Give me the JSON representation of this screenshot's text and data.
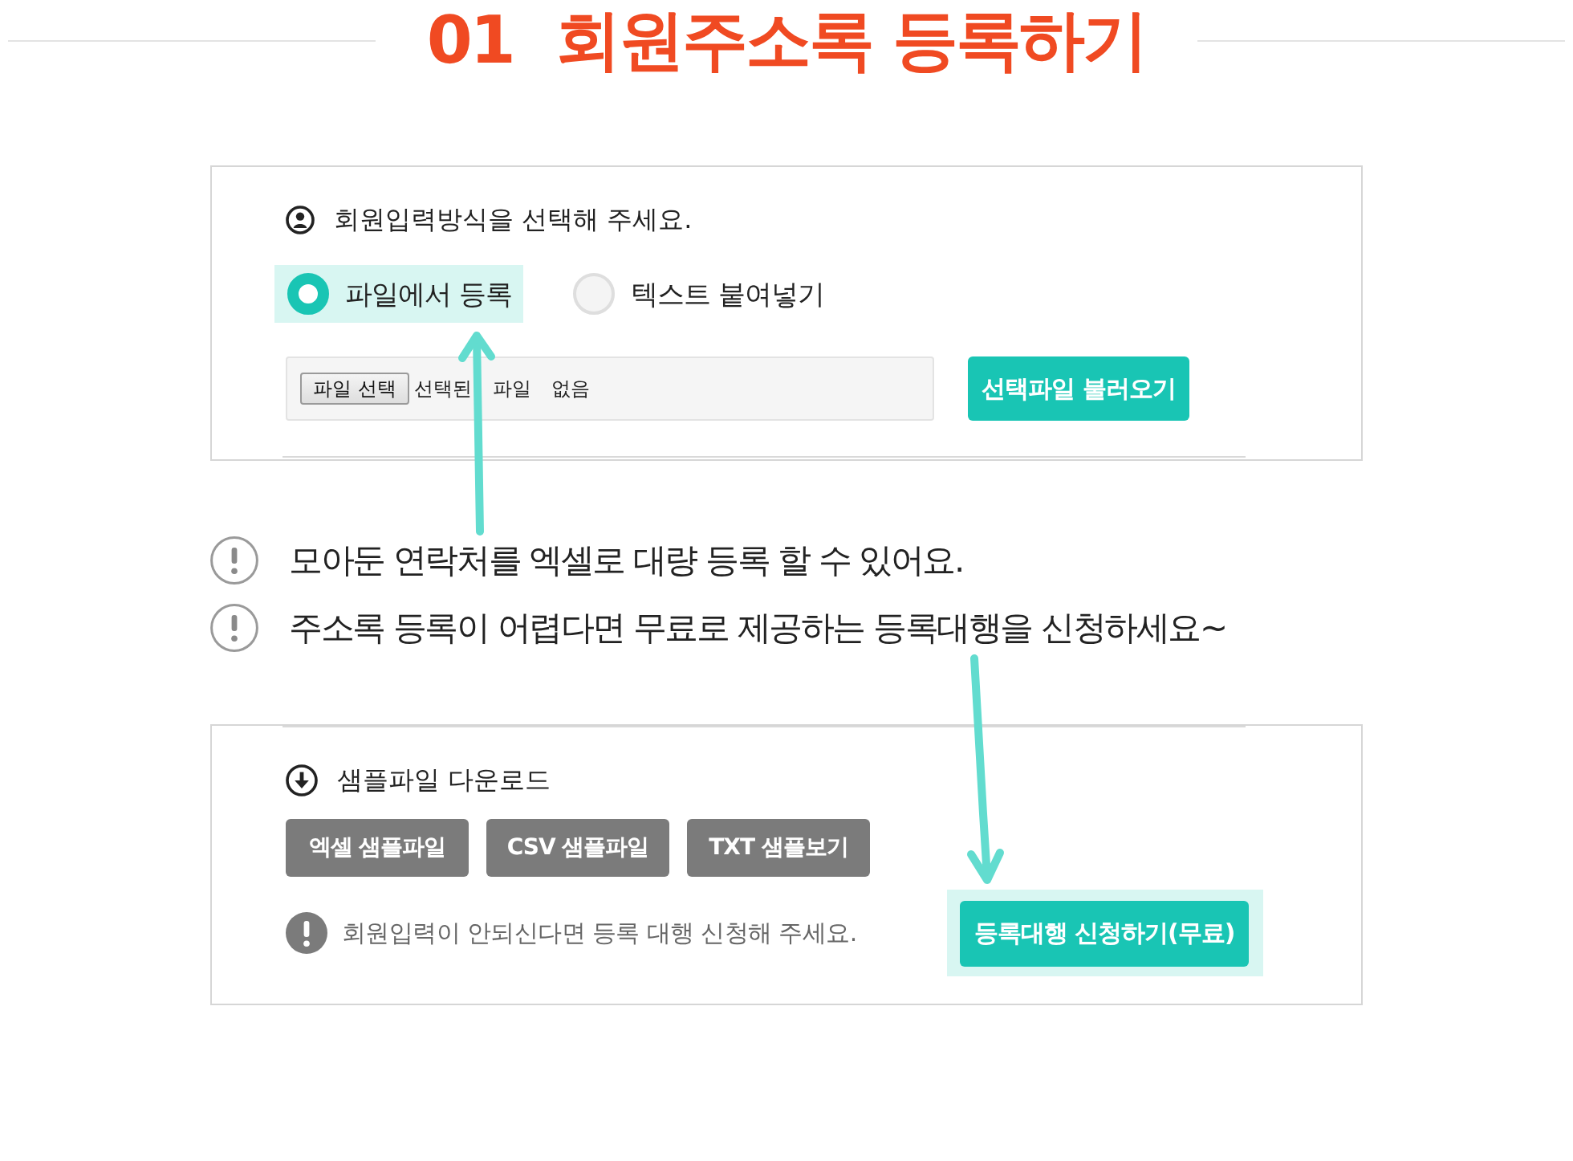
{
  "title": {
    "number": "01",
    "text": "회원주소록 등록하기"
  },
  "input_method": {
    "heading": "회원입력방식을 선택해 주세요.",
    "options": [
      {
        "label": "파일에서 등록",
        "selected": true
      },
      {
        "label": "텍스트 붙여넣기",
        "selected": false
      }
    ],
    "file_field": {
      "button": "파일 선택",
      "value": "선택된 파일 없음"
    },
    "load_button": "선택파일 불러오기"
  },
  "notes": [
    "모아둔 연락처를 엑셀로 대량 등록 할 수 있어요.",
    "주소록 등록이 어렵다면 무료로 제공하는 등록대행을 신청하세요~"
  ],
  "sample_download": {
    "heading": "샘플파일 다운로드",
    "buttons": [
      "엑셀 샘플파일",
      "CSV 샘플파일",
      "TXT 샘플보기"
    ],
    "notice": "회원입력이 안되신다면 등록 대행 신청해 주세요.",
    "request_button": "등록대행 신청하기(무료)"
  }
}
